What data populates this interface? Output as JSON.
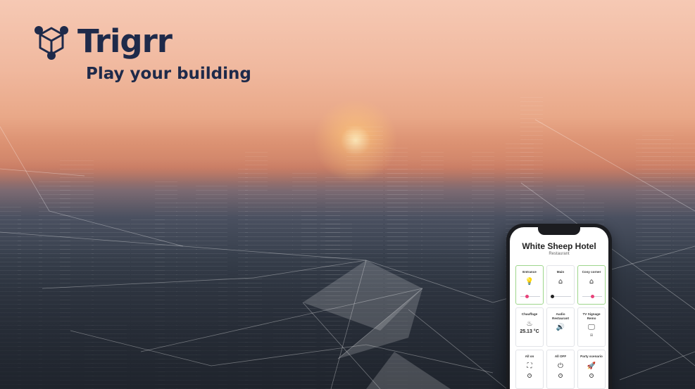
{
  "brand": {
    "name": "Trigrr",
    "tagline": "Play your building",
    "logo_icon": "hexagon-network-icon",
    "colors": {
      "brand_navy": "#1e2a4a"
    }
  },
  "phone": {
    "title": "White Sheep Hotel",
    "subtitle": "Restaurant",
    "accent_on": "#9ed68c",
    "tiles": [
      {
        "label": "Entrance",
        "icon": "light-bulb-icon",
        "glyph": "💡",
        "active": true,
        "slider_level": 0.35,
        "knob_color": "#e8437a"
      },
      {
        "label": "Main",
        "icon": "ceiling-lamp-icon",
        "glyph": "⌂",
        "active": false,
        "slider_level": 0.05,
        "knob_color": "#222222"
      },
      {
        "label": "Cosy corner",
        "icon": "ceiling-lamp-icon",
        "glyph": "⌂",
        "active": true,
        "slider_level": 0.5,
        "knob_color": "#e8437a"
      },
      {
        "label": "Chauffage",
        "icon": "heating-icon",
        "glyph": "♨",
        "active": false,
        "value": "25.13 °C"
      },
      {
        "label": "Audio Restaurant",
        "icon": "speaker-icon",
        "glyph": "🔊",
        "active": false
      },
      {
        "label": "TV Signage Remo",
        "icon": "monitor-icon",
        "glyph": "🖵",
        "active": false,
        "extra": "⊞"
      },
      {
        "label": "All on",
        "icon": "expand-icon",
        "glyph": "⛶",
        "active": false
      },
      {
        "label": "All OFF",
        "icon": "power-icon",
        "glyph": "⏻",
        "active": false
      },
      {
        "label": "Party scenario",
        "icon": "rocket-icon",
        "glyph": "🚀",
        "active": false
      }
    ]
  }
}
